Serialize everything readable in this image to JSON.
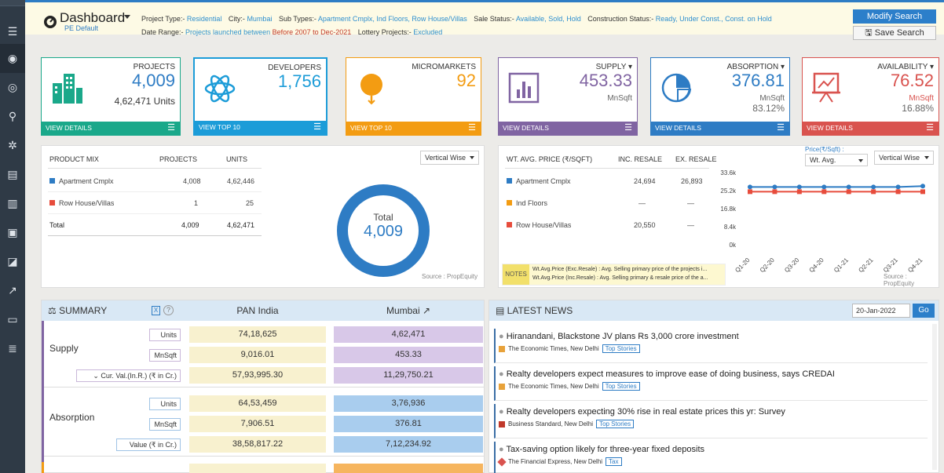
{
  "header": {
    "title": "Dashboard",
    "subtitle": "PE Default",
    "filters_row1": {
      "project_type_label": "Project Type:-",
      "project_type_value": "Residential",
      "city_label": "City:-",
      "city_value": "Mumbai",
      "sub_types_label": "Sub Types:-",
      "sub_types_value": "Apartment Cmplx, Ind Floors, Row House/Villas",
      "sale_status_label": "Sale Status:-",
      "sale_status_value": "Available, Sold, Hold",
      "construction_label": "Construction Status:-",
      "construction_value": "Ready, Under Const., Const. on Hold"
    },
    "filters_row2": {
      "date_range_label": "Date Range:-",
      "date_range_value1": "Projects launched between",
      "date_range_value2": "Before 2007 to Dec-2021",
      "lottery_label": "Lottery Projects:-",
      "lottery_value": "Excluded"
    },
    "modify_label": "Modify Search",
    "save_label": "Save Search"
  },
  "cards": {
    "projects": {
      "title": "PROJECTS",
      "value": "4,009",
      "sub": "4,62,471 Units",
      "link": "VIEW DETAILS",
      "color": "#1aa88a"
    },
    "developers": {
      "title": "DEVELOPERS",
      "value": "1,756",
      "link": "VIEW TOP 10",
      "color": "#1c9cd8"
    },
    "micromarkets": {
      "title": "MICROMARKETS",
      "value": "92",
      "link": "VIEW TOP 10",
      "color": "#f39c12"
    },
    "supply": {
      "title": "SUPPLY",
      "value": "453.33",
      "sub": "MnSqft",
      "link": "VIEW DETAILS",
      "color": "#8064a2"
    },
    "absorption": {
      "title": "ABSORPTION",
      "value": "376.81",
      "sub": "MnSqft",
      "sub2": "83.12%",
      "link": "VIEW DETAILS",
      "color": "#2e7cc4"
    },
    "availability": {
      "title": "AVAILABILITY",
      "value": "76.52",
      "sub": "MnSqft",
      "sub2": "16.88%",
      "link": "VIEW DETAILS",
      "color": "#d9534f"
    }
  },
  "product_mix": {
    "headers": [
      "PRODUCT MIX",
      "PROJECTS",
      "UNITS"
    ],
    "rows": [
      {
        "name": "Apartment Cmplx",
        "projects": "4,008",
        "units": "4,62,446",
        "color": "#2e7cc4"
      },
      {
        "name": "Row House/Villas",
        "projects": "1",
        "units": "25",
        "color": "#e74c3c"
      }
    ],
    "total": {
      "name": "Total",
      "projects": "4,009",
      "units": "4,62,471"
    },
    "dropdown": "Vertical Wise",
    "donut_label": "Total",
    "donut_value": "4,009",
    "source": "Source : PropEquity"
  },
  "price": {
    "headers": [
      "WT. AVG. PRICE (₹/SQFT)",
      "INC. RESALE",
      "EX. RESALE"
    ],
    "rows": [
      {
        "name": "Apartment Cmplx",
        "inc": "24,694",
        "ex": "26,893",
        "color": "#2e7cc4"
      },
      {
        "name": "Ind Floors",
        "inc": "—",
        "ex": "—",
        "color": "#f39c12"
      },
      {
        "name": "Row House/Villas",
        "inc": "20,550",
        "ex": "—",
        "color": "#e74c3c"
      }
    ],
    "notes_label": "NOTES",
    "note1": "Wt.Avg.Price (Exc.Resale) : Avg. Selling primary price of the projects i...",
    "note2": "Wt.Avg.Price (Inc.Resale) : Avg. Selling primary & resale price of the a...",
    "price_dropdown_label": "Price(₹/Sqft) :",
    "price_dropdown": "Wt. Avg.",
    "dropdown": "Vertical Wise",
    "source": "Source : PropEquity"
  },
  "chart_data": {
    "type": "line",
    "x": [
      "Q1-20",
      "Q2-20",
      "Q3-20",
      "Q4-20",
      "Q1-21",
      "Q2-21",
      "Q3-21",
      "Q4-21"
    ],
    "yticks": [
      "33.6k",
      "25.2k",
      "16.8k",
      "8.4k",
      "0k"
    ],
    "ylim": [
      0,
      33600
    ],
    "series": [
      {
        "values": [
          26900,
          26900,
          26900,
          26900,
          26900,
          26900,
          26900,
          27300
        ],
        "color": "#2e7cc4"
      },
      {
        "values": [
          24700,
          24700,
          24700,
          24700,
          24700,
          24700,
          24700,
          24700
        ],
        "color": "#e74c3c"
      }
    ]
  },
  "summary": {
    "title": "SUMMARY",
    "col1": "PAN India",
    "col2": "Mumbai",
    "supply_label": "Supply",
    "absorption_label": "Absorption",
    "units_label": "Units",
    "mnsqft_label": "MnSqft",
    "cur_val_label": "Cur. Val.(In.R.) (₹ in Cr.)",
    "value_label": "Value (₹ in Cr.)",
    "supply_units": [
      "74,18,625",
      "4,62,471"
    ],
    "supply_mnsqft": [
      "9,016.01",
      "453.33"
    ],
    "supply_curval": [
      "57,93,995.30",
      "11,29,750.21"
    ],
    "abs_units": [
      "64,53,459",
      "3,76,936"
    ],
    "abs_mnsqft": [
      "7,906.51",
      "376.81"
    ],
    "abs_value": [
      "38,58,817.22",
      "7,12,234.92"
    ]
  },
  "news": {
    "title": "LATEST NEWS",
    "date": "20-Jan-2022",
    "go": "Go",
    "items": [
      {
        "title": "Hiranandani, Blackstone JV plans Rs 3,000 crore investment",
        "source": "The Economic Times, New Delhi",
        "tag": "Top Stories"
      },
      {
        "title": "Realty developers expect measures to improve ease of doing business, says CREDAI",
        "source": "The Economic Times, New Delhi",
        "tag": "Top Stories"
      },
      {
        "title": "Realty developers expecting 30% rise in real estate prices this yr: Survey",
        "source": "Business Standard, New Delhi",
        "tag": "Top Stories"
      },
      {
        "title": "Tax-saving option likely for three-year fixed deposits",
        "source": "The Financial Express, New Delhi",
        "tag": "Tax"
      }
    ]
  }
}
